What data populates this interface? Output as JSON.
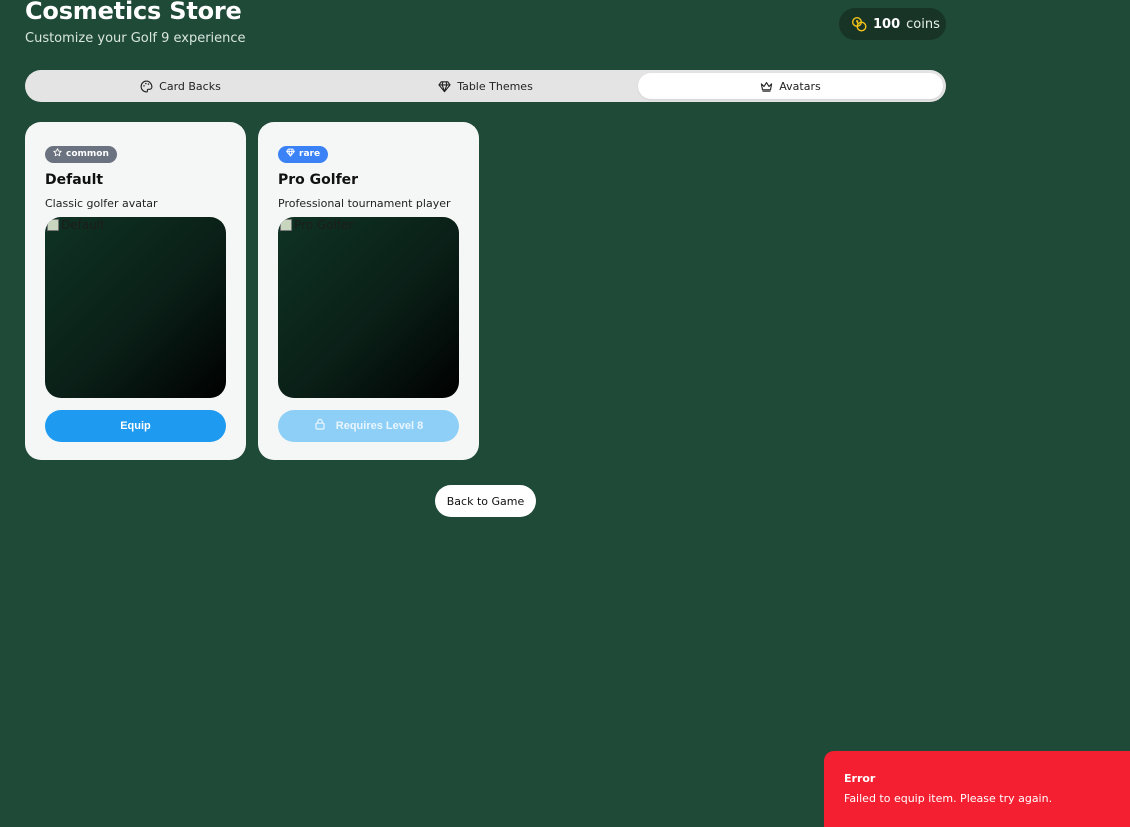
{
  "header": {
    "title": "Cosmetics Store",
    "subtitle": "Customize your Golf 9 experience"
  },
  "wallet": {
    "amount": "100",
    "unit": "coins",
    "icon": "coins-icon",
    "icon_color": "#f5c518"
  },
  "tabs": [
    {
      "label": "Card Backs",
      "icon": "palette-icon",
      "active": false
    },
    {
      "label": "Table Themes",
      "icon": "gem-icon",
      "active": false
    },
    {
      "label": "Avatars",
      "icon": "crown-icon",
      "active": true
    }
  ],
  "items": [
    {
      "rarity": "common",
      "rarity_icon": "star-icon",
      "rarity_color": "#6b7280",
      "name": "Default",
      "description": "Classic golfer avatar",
      "image_alt": "Default",
      "action_label": "Equip",
      "locked": false
    },
    {
      "rarity": "rare",
      "rarity_icon": "gem-icon",
      "rarity_color": "#3b82f6",
      "name": "Pro Golfer",
      "description": "Professional tournament player",
      "image_alt": "Pro Golfer",
      "action_label": "Requires Level 8",
      "action_icon": "lock-icon",
      "locked": true
    }
  ],
  "back_button": {
    "label": "Back to Game"
  },
  "toast": {
    "title": "Error",
    "message": "Failed to equip item. Please try again.",
    "color": "#f51f32"
  },
  "colors": {
    "background": "#1f4a38",
    "accent": "#1e9bf0"
  }
}
